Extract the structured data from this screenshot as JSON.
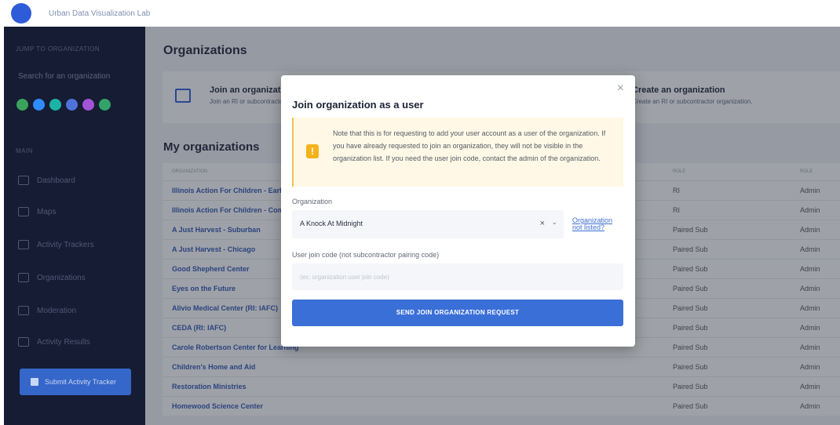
{
  "brand": {
    "name": "Urban Data Visualization Lab"
  },
  "sidebar": {
    "jump_label": "JUMP TO ORGANIZATION",
    "search_placeholder": "Search for an organization",
    "org_icon_colors": [
      "#3aa35b",
      "#2f8cff",
      "#1bb3a8",
      "#4d73d9",
      "#a154d8",
      "#33a36a"
    ],
    "main_label": "MAIN",
    "items": [
      {
        "label": "Dashboard",
        "icon": "home-icon"
      },
      {
        "label": "Maps",
        "icon": "map-icon"
      },
      {
        "label": "Activity Trackers",
        "icon": "bar-chart-icon"
      },
      {
        "label": "Organizations",
        "icon": "users-icon"
      },
      {
        "label": "Moderation",
        "icon": "document-icon"
      },
      {
        "label": "Activity Results",
        "icon": "table-icon"
      }
    ],
    "submit_label": "Submit Activity Tracker"
  },
  "main": {
    "title": "Organizations",
    "join_card": {
      "title": "Join an organization",
      "desc": "Join an RI or subcontractor organization."
    },
    "create_card": {
      "title": "Create an organization",
      "desc": "Create an RI or subcontractor organization."
    },
    "my_orgs_title": "My organizations",
    "table": {
      "headers": {
        "name": "ORGANIZATION",
        "role": "ROLE",
        "perm": "ROLE"
      },
      "rows": [
        {
          "name": "Illinois Action For Children - Early Learning",
          "role": "RI",
          "perm": "Admin"
        },
        {
          "name": "Illinois Action For Children - Community Systems",
          "role": "RI",
          "perm": "Admin"
        },
        {
          "name": "A Just Harvest - Suburban",
          "role": "Paired Sub",
          "perm": "Admin"
        },
        {
          "name": "A Just Harvest - Chicago",
          "role": "Paired Sub",
          "perm": "Admin"
        },
        {
          "name": "Good Shepherd Center",
          "role": "Paired Sub",
          "perm": "Admin"
        },
        {
          "name": "Eyes on the Future",
          "role": "Paired Sub",
          "perm": "Admin"
        },
        {
          "name": "Alivio Medical Center (RI: IAFC)",
          "role": "Paired Sub",
          "perm": "Admin"
        },
        {
          "name": "CEDA (RI: IAFC)",
          "role": "Paired Sub",
          "perm": "Admin"
        },
        {
          "name": "Carole Robertson Center for Learning",
          "role": "Paired Sub",
          "perm": "Admin"
        },
        {
          "name": "Children's Home and Aid",
          "role": "Paired Sub",
          "perm": "Admin"
        },
        {
          "name": "Restoration Ministries",
          "role": "Paired Sub",
          "perm": "Admin"
        },
        {
          "name": "Homewood Science Center",
          "role": "Paired Sub",
          "perm": "Admin"
        }
      ]
    }
  },
  "modal": {
    "title": "Join organization as a user",
    "close_glyph": "×",
    "notice": "Note that this is for requesting to add your user account as a user of the organization. If you have already requested to join an organization, they will not be visible in the organization list. If you need the user join code, contact the admin of the organization.",
    "notice_glyph": "!",
    "org_label": "Organization",
    "org_value": "A Knock At Midnight",
    "clear_glyph": "×",
    "caret_glyph": "⌄",
    "not_listed": "Organization not listed?",
    "join_code_label": "User join code (not subcontractor pairing code)",
    "join_code_placeholder": "(ex: organization user join code)",
    "send_label": "SEND JOIN ORGANIZATION REQUEST"
  }
}
